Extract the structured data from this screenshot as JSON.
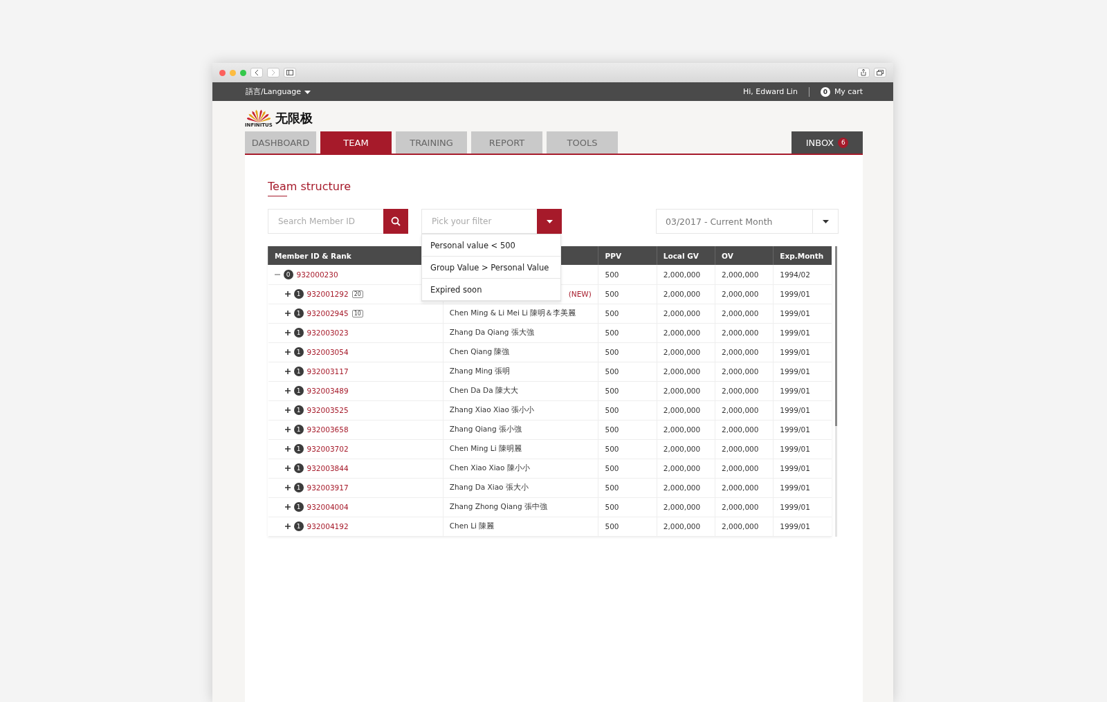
{
  "top_bar": {
    "language": "語言/Language",
    "greeting": "Hi, Edward Lin",
    "cart_count": "0",
    "cart_label": "My cart"
  },
  "logo": {
    "brand": "INFINITUS",
    "name": "无限极"
  },
  "tabs": [
    {
      "label": "DASHBOARD",
      "selected": false
    },
    {
      "label": "TEAM",
      "selected": true
    },
    {
      "label": "TRAINING",
      "selected": false
    },
    {
      "label": "REPORT",
      "selected": false
    },
    {
      "label": "TOOLS",
      "selected": false
    }
  ],
  "inbox": {
    "label": "INBOX",
    "count": "6"
  },
  "section_title": "Team structure",
  "search": {
    "placeholder": "Search Member ID"
  },
  "filter": {
    "placeholder": "Pick your filter",
    "open": true,
    "options": [
      "Personal value < 500",
      "Group Value > Personal Value",
      "Expired soon"
    ]
  },
  "period": {
    "value": "03/2017 - Current Month"
  },
  "table": {
    "columns": [
      "Member ID & Rank",
      "PPV",
      "Local GV",
      "OV",
      "Exp.Month"
    ],
    "rows": [
      {
        "rank": "0",
        "id": "932000230",
        "ppv": "500",
        "local_gv": "2,000,000",
        "ov": "2,000,000",
        "exp": "1994/02",
        "expanded": true,
        "children": [
          {
            "rank": "1",
            "id": "932001292",
            "count": "20",
            "tag": "(NEW)",
            "ppv": "500",
            "local_gv": "2,000,000",
            "ov": "2,000,000",
            "exp": "1999/01",
            "expanded": false
          },
          {
            "rank": "1",
            "id": "932002945",
            "count": "10",
            "name": "Chen Ming & Li Mei Li  陳明＆李美麗",
            "ppv": "500",
            "local_gv": "2,000,000",
            "ov": "2,000,000",
            "exp": "1999/01",
            "expanded": false
          },
          {
            "rank": "1",
            "id": "932003023",
            "name": "Zhang Da Qiang  張大強",
            "ppv": "500",
            "local_gv": "2,000,000",
            "ov": "2,000,000",
            "exp": "1999/01",
            "expanded": false
          },
          {
            "rank": "1",
            "id": "932003054",
            "name": "Chen Qiang  陳強",
            "ppv": "500",
            "local_gv": "2,000,000",
            "ov": "2,000,000",
            "exp": "1999/01",
            "expanded": false
          },
          {
            "rank": "1",
            "id": "932003117",
            "name": "Zhang Ming  張明",
            "ppv": "500",
            "local_gv": "2,000,000",
            "ov": "2,000,000",
            "exp": "1999/01",
            "expanded": false
          },
          {
            "rank": "1",
            "id": "932003489",
            "name": "Chen Da Da  陳大大",
            "ppv": "500",
            "local_gv": "2,000,000",
            "ov": "2,000,000",
            "exp": "1999/01",
            "expanded": false
          },
          {
            "rank": "1",
            "id": "932003525",
            "name": "Zhang Xiao Xiao  張小小",
            "ppv": "500",
            "local_gv": "2,000,000",
            "ov": "2,000,000",
            "exp": "1999/01",
            "expanded": false
          },
          {
            "rank": "1",
            "id": "932003658",
            "name": "Zhang Qiang  張小強",
            "ppv": "500",
            "local_gv": "2,000,000",
            "ov": "2,000,000",
            "exp": "1999/01",
            "expanded": false
          },
          {
            "rank": "1",
            "id": "932003702",
            "name": "Chen Ming Li  陳明麗",
            "ppv": "500",
            "local_gv": "2,000,000",
            "ov": "2,000,000",
            "exp": "1999/01",
            "expanded": false
          },
          {
            "rank": "1",
            "id": "932003844",
            "name": "Chen Xiao Xiao  陳小小",
            "ppv": "500",
            "local_gv": "2,000,000",
            "ov": "2,000,000",
            "exp": "1999/01",
            "expanded": false
          },
          {
            "rank": "1",
            "id": "932003917",
            "name": "Zhang Da Xiao  張大小",
            "ppv": "500",
            "local_gv": "2,000,000",
            "ov": "2,000,000",
            "exp": "1999/01",
            "expanded": false
          },
          {
            "rank": "1",
            "id": "932004004",
            "name": "Zhang Zhong Qiang  張中強",
            "ppv": "500",
            "local_gv": "2,000,000",
            "ov": "2,000,000",
            "exp": "1999/01",
            "expanded": false
          },
          {
            "rank": "1",
            "id": "932004192",
            "name": "Chen Li  陳麗",
            "ppv": "500",
            "local_gv": "2,000,000",
            "ov": "2,000,000",
            "exp": "1999/01",
            "expanded": false
          }
        ]
      }
    ]
  }
}
